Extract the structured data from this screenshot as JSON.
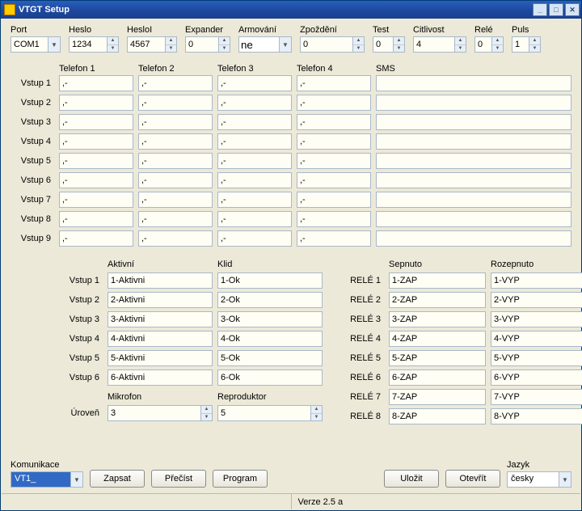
{
  "window": {
    "title": "VTGT Setup"
  },
  "top": {
    "port": {
      "label": "Port",
      "value": "COM1"
    },
    "heslo": {
      "label": "Heslo",
      "value": "1234"
    },
    "heslol": {
      "label": "HesloI",
      "value": "4567"
    },
    "expander": {
      "label": "Expander",
      "value": "0"
    },
    "armovani": {
      "label": "Armování",
      "value": "ne"
    },
    "zpozdeni": {
      "label": "Zpoždění",
      "value": "0"
    },
    "test": {
      "label": "Test",
      "value": "0"
    },
    "citlivost": {
      "label": "Citlivost",
      "value": "4"
    },
    "rele": {
      "label": "Relé",
      "value": "0"
    },
    "puls": {
      "label": "Puls",
      "value": "1"
    }
  },
  "phone_headers": [
    "Telefon 1",
    "Telefon 2",
    "Telefon 3",
    "Telefon 4",
    "SMS"
  ],
  "vstup_labels": [
    "Vstup 1",
    "Vstup 2",
    "Vstup 3",
    "Vstup 4",
    "Vstup 5",
    "Vstup 6",
    "Vstup 7",
    "Vstup 8",
    "Vstup 9"
  ],
  "phones": [
    {
      "t1": ",-",
      "t2": ",-",
      "t3": ",-",
      "t4": ",-",
      "sms": ""
    },
    {
      "t1": ",-",
      "t2": ",-",
      "t3": ",-",
      "t4": ",-",
      "sms": ""
    },
    {
      "t1": ",-",
      "t2": ",-",
      "t3": ",-",
      "t4": ",-",
      "sms": ""
    },
    {
      "t1": ",-",
      "t2": ",-",
      "t3": ",-",
      "t4": ",-",
      "sms": ""
    },
    {
      "t1": ",-",
      "t2": ",-",
      "t3": ",-",
      "t4": ",-",
      "sms": ""
    },
    {
      "t1": ",-",
      "t2": ",-",
      "t3": ",-",
      "t4": ",-",
      "sms": ""
    },
    {
      "t1": ",-",
      "t2": ",-",
      "t3": ",-",
      "t4": ",-",
      "sms": ""
    },
    {
      "t1": ",-",
      "t2": ",-",
      "t3": ",-",
      "t4": ",-",
      "sms": ""
    },
    {
      "t1": ",-",
      "t2": ",-",
      "t3": ",-",
      "t4": ",-",
      "sms": ""
    }
  ],
  "aktivni_hd": "Aktivní",
  "klid_hd": "Klid",
  "vstup_rows": [
    {
      "lbl": "Vstup 1",
      "a": "1-Aktivni",
      "k": "1-Ok"
    },
    {
      "lbl": "Vstup 2",
      "a": "2-Aktivni",
      "k": "2-Ok"
    },
    {
      "lbl": "Vstup 3",
      "a": "3-Aktivni",
      "k": "3-Ok"
    },
    {
      "lbl": "Vstup 4",
      "a": "4-Aktivni",
      "k": "4-Ok"
    },
    {
      "lbl": "Vstup 5",
      "a": "5-Aktivni",
      "k": "5-Ok"
    },
    {
      "lbl": "Vstup 6",
      "a": "6-Aktivni",
      "k": "6-Ok"
    }
  ],
  "mikrofon_hd": "Mikrofon",
  "reproduktor_hd": "Reproduktor",
  "uroven_lbl": "Úroveň",
  "mikrofon_val": "3",
  "reproduktor_val": "5",
  "sepnuto_hd": "Sepnuto",
  "rozepnuto_hd": "Rozepnuto",
  "rele_rows": [
    {
      "lbl": "RELÉ 1",
      "s": "1-ZAP",
      "r": "1-VYP"
    },
    {
      "lbl": "RELÉ 2",
      "s": "2-ZAP",
      "r": "2-VYP"
    },
    {
      "lbl": "RELÉ 3",
      "s": "3-ZAP",
      "r": "3-VYP"
    },
    {
      "lbl": "RELÉ 4",
      "s": "4-ZAP",
      "r": "4-VYP"
    },
    {
      "lbl": "RELÉ 5",
      "s": "5-ZAP",
      "r": "5-VYP"
    },
    {
      "lbl": "RELÉ 6",
      "s": "6-ZAP",
      "r": "6-VYP"
    },
    {
      "lbl": "RELÉ 7",
      "s": "7-ZAP",
      "r": "7-VYP"
    },
    {
      "lbl": "RELÉ 8",
      "s": "8-ZAP",
      "r": "8-VYP"
    }
  ],
  "footer": {
    "komunikace_lbl": "Komunikace",
    "komunikace_val": "VT1_",
    "zapsat": "Zapsat",
    "precist": "Přečíst",
    "program": "Program",
    "ulozit": "Uložit",
    "otevrit": "Otevřít",
    "jazyk_lbl": "Jazyk",
    "jazyk_val": "česky"
  },
  "status": {
    "version": "Verze 2.5 a"
  }
}
